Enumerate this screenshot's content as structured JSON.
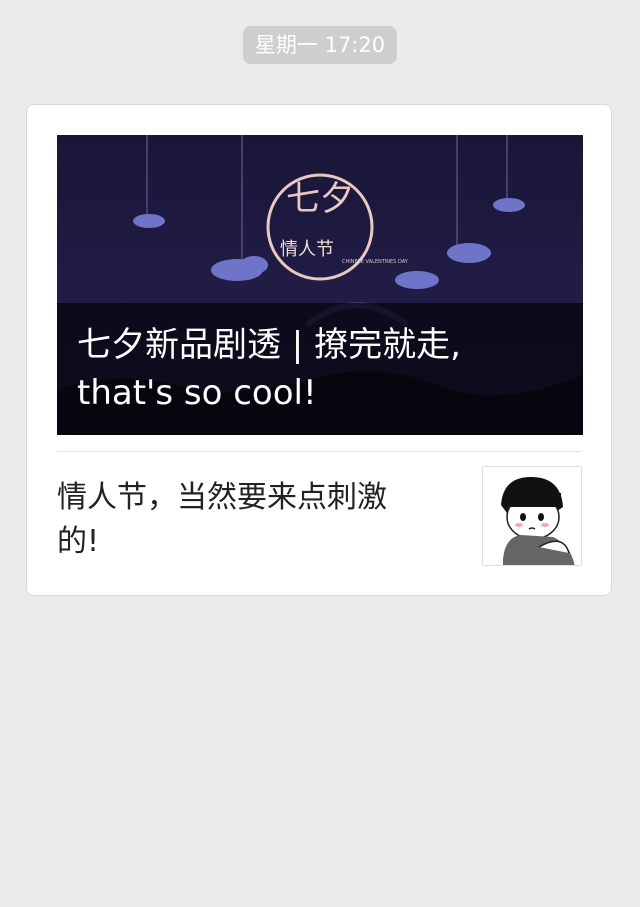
{
  "chat": {
    "timestamp": "星期一 17:20"
  },
  "article": {
    "cover_title": "七夕新品剧透 | 撩完就走, that's so cool!",
    "cover_logo_main": "七夕",
    "cover_logo_sub": "情人节",
    "cover_logo_en": "CHINESE VALENTINES DAY",
    "summary": "情人节，当然要来点刺激的!",
    "colors": {
      "cover_bg": "#1c1840",
      "cloud": "#6e74c8",
      "logo_ring": "#e8c9c2"
    }
  }
}
